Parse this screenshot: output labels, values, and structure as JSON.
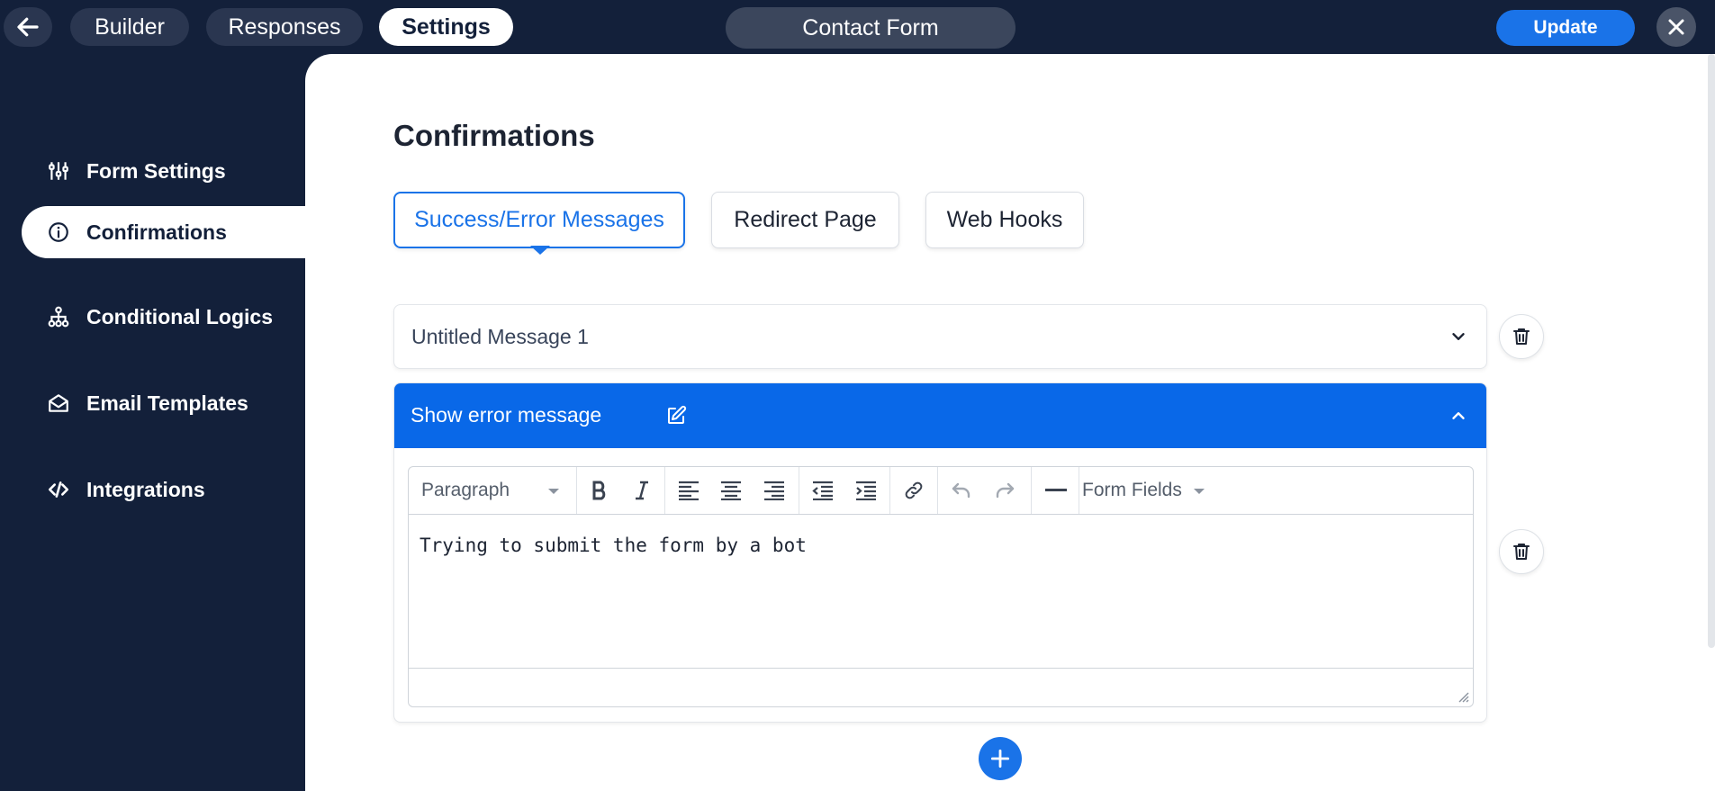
{
  "topbar": {
    "tabs": [
      {
        "label": "Builder",
        "active": false
      },
      {
        "label": "Responses",
        "active": false
      },
      {
        "label": "Settings",
        "active": true
      }
    ],
    "form_title": "Contact Form",
    "update_label": "Update"
  },
  "sidebar": {
    "items": [
      {
        "label": "Form Settings",
        "icon": "sliders-icon",
        "active": false
      },
      {
        "label": "Confirmations",
        "icon": "info-icon",
        "active": true
      },
      {
        "label": "Conditional Logics",
        "icon": "hierarchy-icon",
        "active": false
      },
      {
        "label": "Email Templates",
        "icon": "envelope-open-icon",
        "active": false
      },
      {
        "label": "Integrations",
        "icon": "code-icon",
        "active": false
      }
    ]
  },
  "main": {
    "title": "Confirmations",
    "subtabs": [
      {
        "label": "Success/Error Messages",
        "active": true
      },
      {
        "label": "Redirect Page",
        "active": false
      },
      {
        "label": "Web Hooks",
        "active": false
      }
    ],
    "messages": [
      {
        "title": "Untitled Message 1",
        "expanded": false
      },
      {
        "title": "Show error message",
        "expanded": true
      }
    ],
    "editor": {
      "format": "Paragraph",
      "form_fields": "Form Fields",
      "content": "Trying to submit the form by a bot"
    }
  },
  "colors": {
    "navy": "#13203a",
    "accent": "#1a73e8",
    "header_blue": "#0968e8"
  }
}
